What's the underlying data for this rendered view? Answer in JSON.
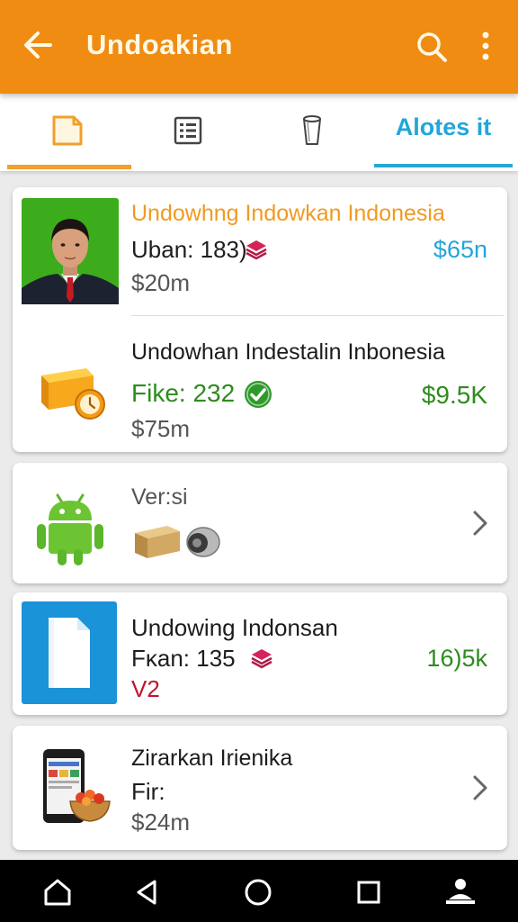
{
  "app_bar": {
    "title": "Undoakian",
    "back_icon": "arrow-left-icon",
    "search_icon": "search-icon",
    "more_icon": "more-vertical-icon",
    "color": "#f08c12"
  },
  "tabs": [
    {
      "icon": "document-icon",
      "selected": true
    },
    {
      "icon": "list-grid-icon",
      "selected": false
    },
    {
      "icon": "cup-icon",
      "selected": false
    },
    {
      "label": "Alotes it",
      "selected": false
    }
  ],
  "cards": [
    {
      "rows": [
        {
          "image": "person-photo",
          "title": "Undowhng Indowkan Indonesia",
          "stat": "Uban: 183)",
          "stat_icon": "layers-icon",
          "price": "$20m",
          "amount": "$65n",
          "amount_color": "#22a6d9"
        },
        {
          "image": "box-clock-image",
          "title": "Undowhan Indestalin Inbonesia",
          "stat": "Fike: 232",
          "stat_icon": "check-circle-icon",
          "price": "$75m",
          "amount": "$9.5K",
          "amount_color": "#2e8b1e"
        }
      ]
    },
    {
      "rows": [
        {
          "image": "android-robot-icon",
          "title": "Ver:si",
          "media": "box-speaker-image",
          "chevron": "chevron-right-icon"
        }
      ]
    },
    {
      "rows": [
        {
          "image": "document-tile-image",
          "title": "Undowing Indonsan",
          "stat": "Fκan: 135",
          "stat_icon": "layers-icon",
          "version": "V2",
          "amount": "16)5k",
          "amount_color": "#2e8b1e"
        }
      ]
    },
    {
      "rows": [
        {
          "image": "phone-food-image",
          "title": "Zirarkan Irienika",
          "stat": "Fir:",
          "price": "$24m",
          "chevron": "chevron-right-icon"
        }
      ]
    }
  ],
  "nav_bar": {
    "items": [
      "home-icon",
      "back-triangle-icon",
      "circle-home-icon",
      "square-recents-icon",
      "person-icon"
    ]
  }
}
